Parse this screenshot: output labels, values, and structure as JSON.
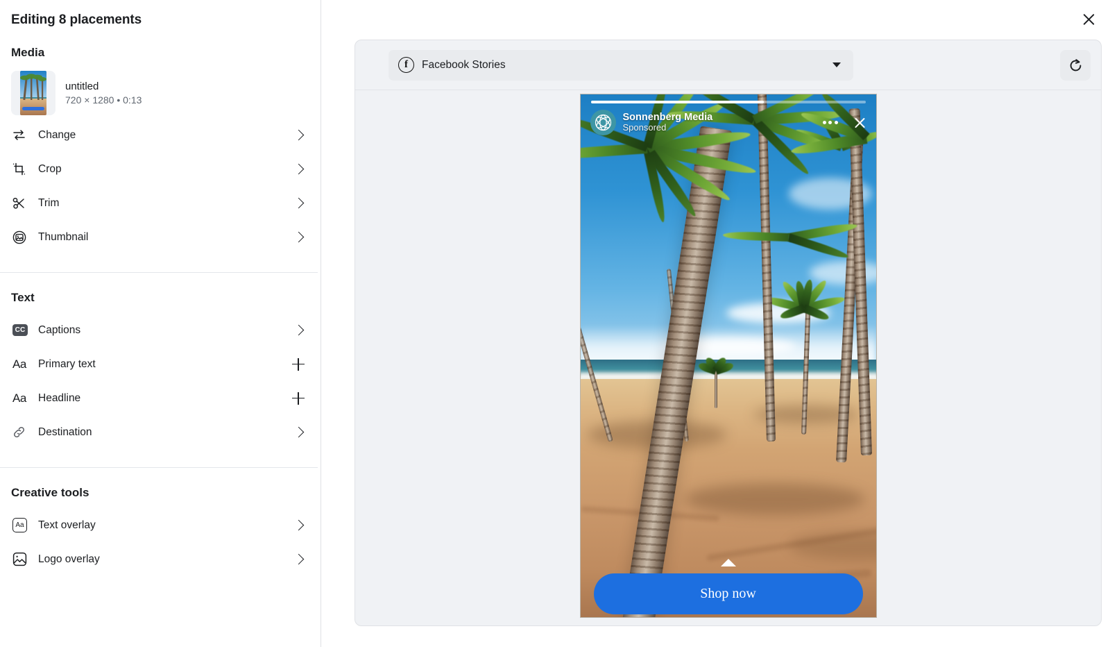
{
  "dialog": {
    "title": "Editing 8 placements",
    "close_icon": "close-icon"
  },
  "sidebar": {
    "sections": [
      {
        "header": "Media",
        "media": {
          "name": "untitled",
          "details": "720 × 1280 • 0:13"
        },
        "rows": [
          {
            "label": "Change",
            "icon": "swap-arrows-icon",
            "affordance": "chevron-right"
          },
          {
            "label": "Crop",
            "icon": "crop-icon",
            "affordance": "chevron-right"
          },
          {
            "label": "Trim",
            "icon": "scissors-icon",
            "affordance": "chevron-right"
          },
          {
            "label": "Thumbnail",
            "icon": "image-circle-icon",
            "affordance": "chevron-right"
          }
        ]
      },
      {
        "header": "Text",
        "rows": [
          {
            "label": "Captions",
            "icon": "cc-icon",
            "affordance": "chevron-right"
          },
          {
            "label": "Primary text",
            "icon": "aa-icon",
            "affordance": "plus"
          },
          {
            "label": "Headline",
            "icon": "aa-icon",
            "affordance": "plus"
          },
          {
            "label": "Destination",
            "icon": "link-icon",
            "affordance": "chevron-right"
          }
        ]
      },
      {
        "header": "Creative tools",
        "rows": [
          {
            "label": "Text overlay",
            "icon": "aa-box-icon",
            "affordance": "chevron-right"
          },
          {
            "label": "Logo overlay",
            "icon": "image-box-icon",
            "affordance": "chevron-right"
          }
        ]
      }
    ]
  },
  "preview": {
    "placement_selector": {
      "value": "Facebook Stories",
      "icon": "facebook-icon",
      "caret": "chevron-down-icon"
    },
    "refresh_button": {
      "icon": "refresh-icon"
    },
    "story": {
      "progress_percent": 63,
      "brand_name": "Sonnenberg Media",
      "sponsored_label": "Sponsored",
      "avatar_icon": "brand-logo-icon",
      "more_icon": "more-options-icon",
      "close_icon": "close-icon",
      "swipe_up_icon": "chevron-up-icon",
      "cta_label": "Shop now",
      "cta_color": "#1d6fe0"
    }
  },
  "colors": {
    "panel_bg": "#f0f2f5",
    "text_primary": "#1c1e21",
    "text_secondary": "#606770",
    "border": "#dfe1e5",
    "accent_blue": "#1d6fe0",
    "avatar_teal": "#3e96a5"
  }
}
